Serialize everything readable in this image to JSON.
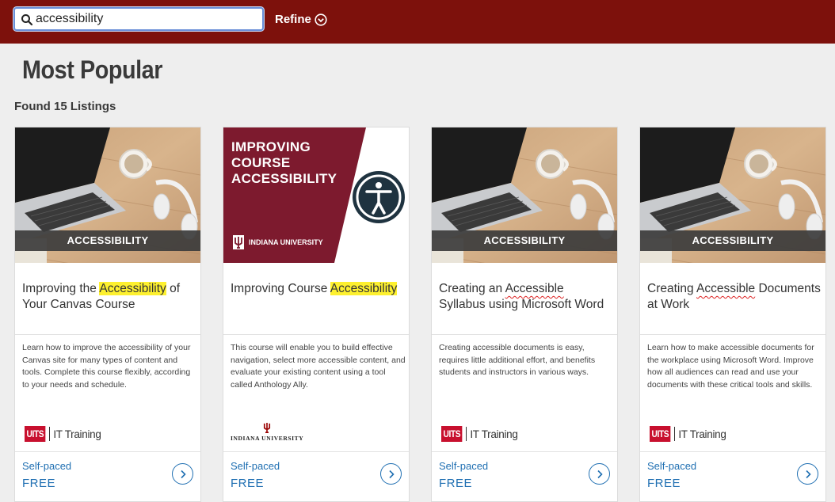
{
  "search": {
    "value": "accessibility"
  },
  "refine": {
    "label": "Refine"
  },
  "page": {
    "title": "Most Popular",
    "found": "Found 15 Listings"
  },
  "colors": {
    "topbar": "#7d110c",
    "link": "#1f6fb2",
    "highlight": "#fdf02f",
    "iu_crimson": "#7d1a2e"
  },
  "cards": [
    {
      "banner": "ACCESSIBILITY",
      "title_pre": "Improving the ",
      "title_hl": "Accessibility",
      "title_post": " of Your Canvas Course",
      "description": "Learn how to improve the accessibility of your Canvas site for many types of content and tools. Complete this course flexibly, according to your needs and schedule.",
      "logo": {
        "mark": "UITS",
        "text": "IT Training"
      },
      "pace": "Self-paced",
      "price": "FREE"
    },
    {
      "thumb_title": "IMPROVING COURSE ACCESSIBILITY",
      "thumb_sub": "INDIANA UNIVERSITY",
      "title_pre": "Improving Course ",
      "title_hl": "Accessibility",
      "title_post": "",
      "description": "This course will enable you to build effective navigation, select more accessible content, and evaluate your existing content using a tool called Anthology Ally.",
      "logo": {
        "text": "INDIANA UNIVERSITY"
      },
      "pace": "Self-paced",
      "price": "FREE"
    },
    {
      "banner": "ACCESSIBILITY",
      "title_pre": "Creating an ",
      "title_hl": "Accessible",
      "title_post": " Syllabus using Microsoft Word",
      "description": "Creating accessible documents is easy, requires little additional effort, and benefits students and instructors in various ways.",
      "logo": {
        "mark": "UITS",
        "text": "IT Training"
      },
      "pace": "Self-paced",
      "price": "FREE"
    },
    {
      "banner": "ACCESSIBILITY",
      "title_pre": "Creating ",
      "title_hl": "Accessible",
      "title_post": " Documents at Work",
      "description": "Learn how to make accessible documents for the workplace using Microsoft Word. Improve how all audiences can read and use your documents with these critical tools and skills.",
      "logo": {
        "mark": "UITS",
        "text": "IT Training"
      },
      "pace": "Self-paced",
      "price": "FREE"
    }
  ]
}
